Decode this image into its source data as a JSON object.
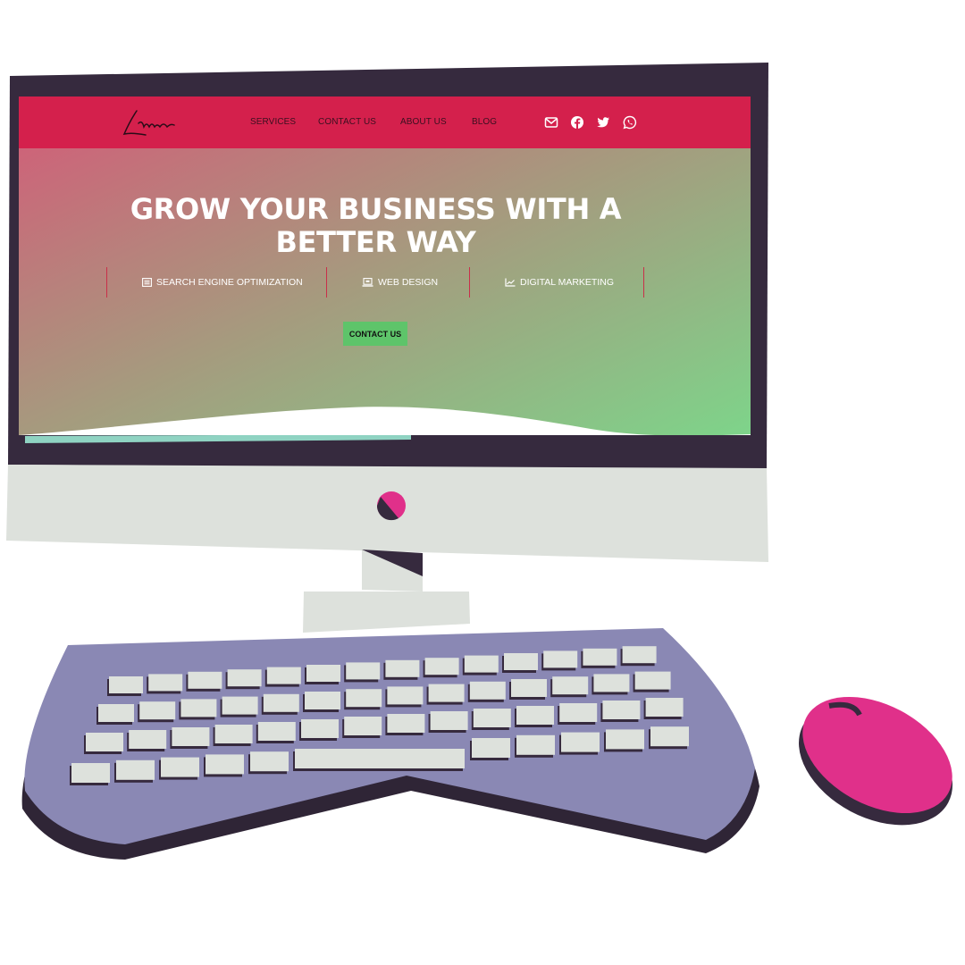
{
  "site": {
    "logo_text": "Letheio",
    "nav": [
      {
        "label": "SERVICES"
      },
      {
        "label": "CONTACT US"
      },
      {
        "label": "ABOUT US"
      },
      {
        "label": "BLOG"
      }
    ],
    "social_icons": [
      "mail-icon",
      "facebook-icon",
      "twitter-icon",
      "whatsapp-icon"
    ]
  },
  "hero": {
    "headline_line1": "GROW YOUR BUSINESS WITH A",
    "headline_line2": "BETTER WAY",
    "services": [
      {
        "label": "SEARCH ENGINE OPTIMIZATION",
        "icon": "list-icon"
      },
      {
        "label": "WEB DESIGN",
        "icon": "laptop-icon"
      },
      {
        "label": "DIGITAL MARKETING",
        "icon": "chart-line-icon"
      }
    ],
    "cta_label": "CONTACT US"
  },
  "colors": {
    "navbar": "#d4204c",
    "gradient_start": "#d45a78",
    "gradient_end": "#7ed48a",
    "cta": "#5ec46a",
    "monitor_frame": "#362a3e",
    "monitor_chin": "#dde1dc",
    "keyboard": "#8a88b4",
    "accent_pink": "#e0308a"
  }
}
